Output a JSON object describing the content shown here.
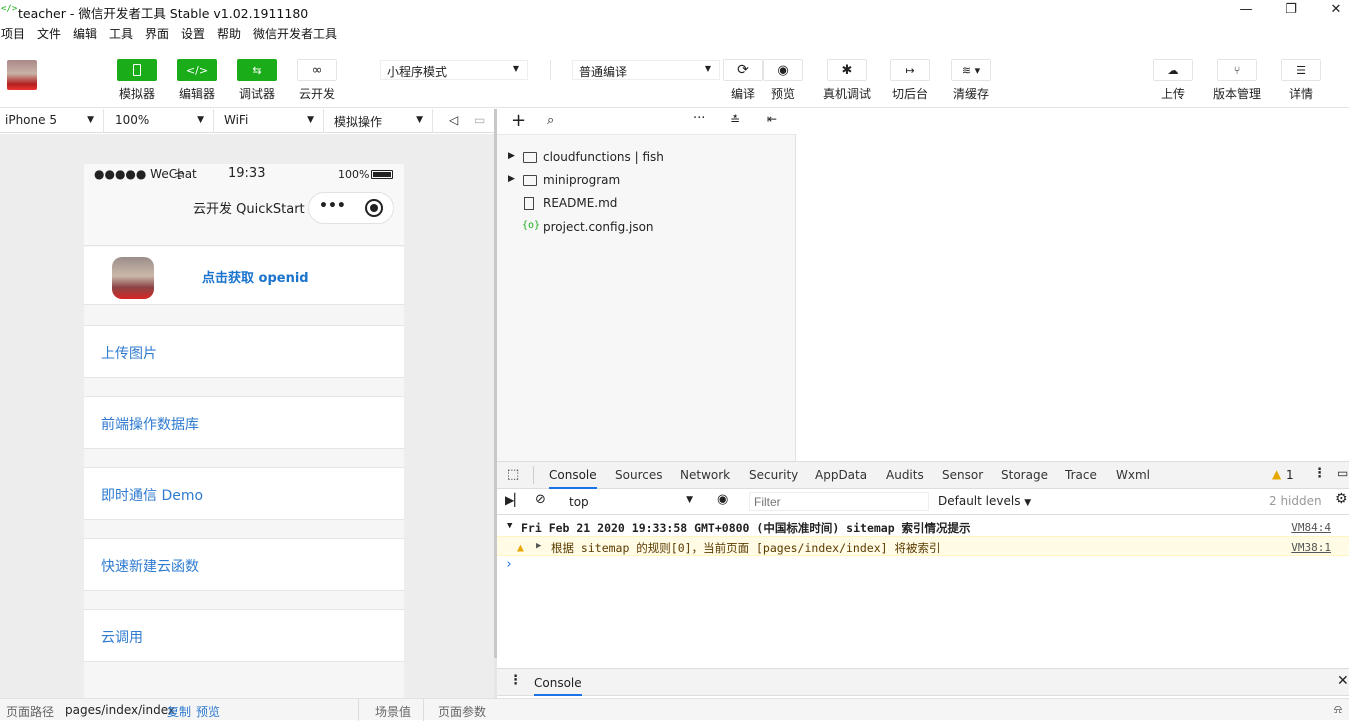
{
  "window": {
    "title": "teacher - 微信开发者工具 Stable v1.02.1911180"
  },
  "menu": [
    "项目",
    "文件",
    "编辑",
    "工具",
    "界面",
    "设置",
    "帮助",
    "微信开发者工具"
  ],
  "toolbar": {
    "simulator": "模拟器",
    "editor": "编辑器",
    "debugger": "调试器",
    "cloud": "云开发",
    "mode": "小程序模式",
    "compile_mode": "普通编译",
    "compile": "编译",
    "preview": "预览",
    "remote_debug": "真机调试",
    "background": "切后台",
    "clear_cache": "清缓存",
    "upload": "上传",
    "version": "版本管理",
    "detail": "详情"
  },
  "device_bar": {
    "device": "iPhone 5",
    "zoom": "100%",
    "network": "WiFi",
    "operation": "模拟操作"
  },
  "phone": {
    "signal": "●●●●● WeChat",
    "time": "19:33",
    "battery": "100%",
    "nav_title": "云开发 QuickStart",
    "get_openid": "点击获取 openid",
    "items": [
      "上传图片",
      "前端操作数据库",
      "即时通信 Demo",
      "快速新建云函数",
      "云调用"
    ]
  },
  "files": [
    {
      "name": "cloudfunctions | fish",
      "type": "folder"
    },
    {
      "name": "miniprogram",
      "type": "folder"
    },
    {
      "name": "README.md",
      "type": "file"
    },
    {
      "name": "project.config.json",
      "type": "config"
    }
  ],
  "devtools": {
    "tabs": [
      "Console",
      "Sources",
      "Network",
      "Security",
      "AppData",
      "Audits",
      "Sensor",
      "Storage",
      "Trace",
      "Wxml"
    ],
    "warn_count": "1",
    "context": "top",
    "filter_placeholder": "Filter",
    "levels": "Default levels",
    "hidden": "2 hidden",
    "log_header": "Fri Feb 21 2020 19:33:58 GMT+0800 (中国标准时间) sitemap 索引情况提示",
    "log_header_src": "VM84:4",
    "log_warn": "根据 sitemap 的规则[0]，当前页面 [pages/index/index] 将被索引",
    "log_warn_src": "VM38:1",
    "drawer_tab": "Console"
  },
  "footer": {
    "path_label": "页面路径",
    "path": "pages/index/index",
    "copy": "复制",
    "preview": "预览",
    "scene": "场景值",
    "params": "页面参数"
  }
}
